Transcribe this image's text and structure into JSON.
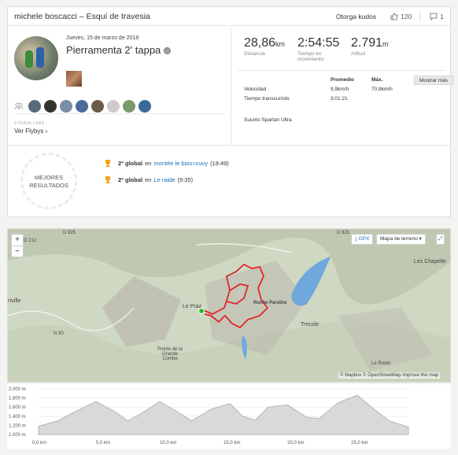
{
  "header": {
    "title": "michele boscacci – Esquí de travesia",
    "kudos_button": "Otorga kudos",
    "kudos_count": "120",
    "comment_count": "1"
  },
  "activity": {
    "date": "Jueves, 15 de marzo de 2018",
    "title": "Pierramenta 2' tappa",
    "strava_labs": "STRAVA LABS",
    "flybys_link": "Ver Flybys"
  },
  "stats": {
    "distance_value": "28,86",
    "distance_unit": "km",
    "distance_label": "Distancia",
    "time_value": "2:54:55",
    "time_label": "Tiempo en movimiento",
    "elev_value": "2.791",
    "elev_unit": "m",
    "elev_label": "Altitud",
    "col_avg": "Promedio",
    "col_max": "Máx.",
    "show_more": "Mostrar más",
    "speed_label": "Velocidad",
    "speed_avg": "9,9km/h",
    "speed_max": "70,9km/h",
    "total_time_label": "Tiempo transcurrido",
    "total_time": "3:01:21",
    "device": "Suunto Spartan Ultra"
  },
  "achievements": {
    "heading": "MEJORES RESULTADOS",
    "items": [
      {
        "rank": "2º global",
        "pre": "en",
        "segment": "montée le bois>cuvy",
        "time": "(19:49)"
      },
      {
        "rank": "2º global",
        "pre": "en",
        "segment": "Le raide",
        "time": "(9:35)"
      }
    ]
  },
  "map": {
    "gpx": "GPX",
    "map_type": "Mapa de terreno",
    "zoom_in": "+",
    "zoom_out": "−",
    "attribution": "© Mapbox © OpenStreetMap Improve this map",
    "labels": {
      "le_praz": "Le Praz",
      "roche_parstire": "Roche Parstire",
      "grande_combe": "Pointe de la Grande Combe",
      "tresale": "Trecole",
      "chappelle": "Les Chapelle",
      "rtville": "rtville",
      "le_reposoir": "Le Rozet",
      "road1": "D 925",
      "road2": "N 90",
      "road3": "D 212",
      "road4": "D 925"
    },
    "colors": {
      "route": "#e0262a",
      "lake": "#6fa8dc"
    }
  },
  "chart_data": {
    "type": "area",
    "x_unit": "km",
    "y_ticks": [
      "2.000 m",
      "1.800 m",
      "1.600 m",
      "1.400 m",
      "1.200 m",
      "1.000 m"
    ],
    "x_ticks": [
      "0,0 km",
      "5,0 km",
      "10,0 km",
      "15,0 km",
      "20,0 km",
      "25,0 km"
    ],
    "ylim": [
      1000,
      2000
    ],
    "xlim": [
      0,
      29
    ],
    "x": [
      0,
      1.5,
      3,
      4.5,
      6,
      7,
      8,
      9.5,
      11,
      12,
      13.5,
      15,
      16,
      17,
      18,
      19.5,
      21,
      22,
      23.5,
      25,
      26,
      27.5,
      29
    ],
    "y": [
      1180,
      1300,
      1520,
      1720,
      1500,
      1300,
      1450,
      1720,
      1480,
      1300,
      1550,
      1680,
      1400,
      1320,
      1600,
      1650,
      1380,
      1350,
      1700,
      1860,
      1620,
      1300,
      1160
    ]
  }
}
